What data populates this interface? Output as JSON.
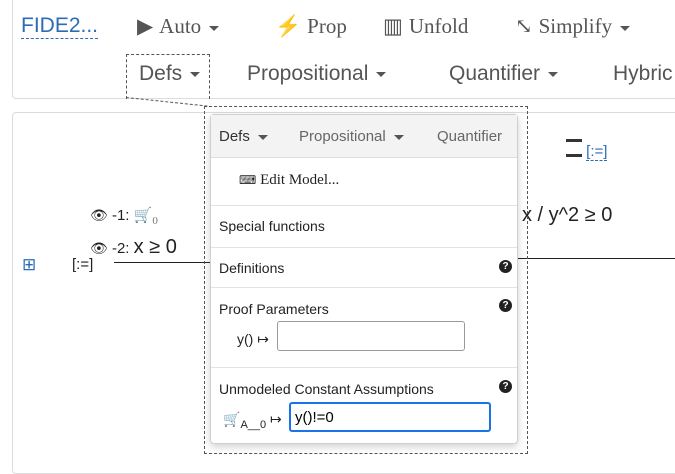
{
  "toolbar": {
    "title": "FIDE2...",
    "auto": "Auto",
    "prop": "Prop",
    "unfold": "Unfold",
    "simplify": "Simplify"
  },
  "menu": {
    "defs": "Defs",
    "propositional": "Propositional",
    "quantifier": "Quantifier",
    "hybrid": "Hybric"
  },
  "sequent": {
    "ante1_label": "-1:",
    "ante1_sub": "0",
    "ante2_label": "-2:",
    "ante2_formula": "x ≥ 0",
    "plus": "⊞",
    "step": "[:=]",
    "succ_formula": "x / y^2 ≥ 0",
    "tactic": "[:=]"
  },
  "dropdown": {
    "tabs": [
      "Defs",
      "Propositional",
      "Quantifier"
    ],
    "edit_model": "Edit Model...",
    "special_functions": "Special functions",
    "definitions": "Definitions",
    "proof_parameters": "Proof Parameters",
    "param_label": "y() ↦",
    "param_value": "",
    "unmodeled": "Unmodeled Constant Assumptions",
    "assump_sub": "A__0",
    "assump_arrow": "↦",
    "assump_value": "y()!=0"
  },
  "colors": {
    "accent": "#2a6db5",
    "focus": "#1a73e8"
  }
}
